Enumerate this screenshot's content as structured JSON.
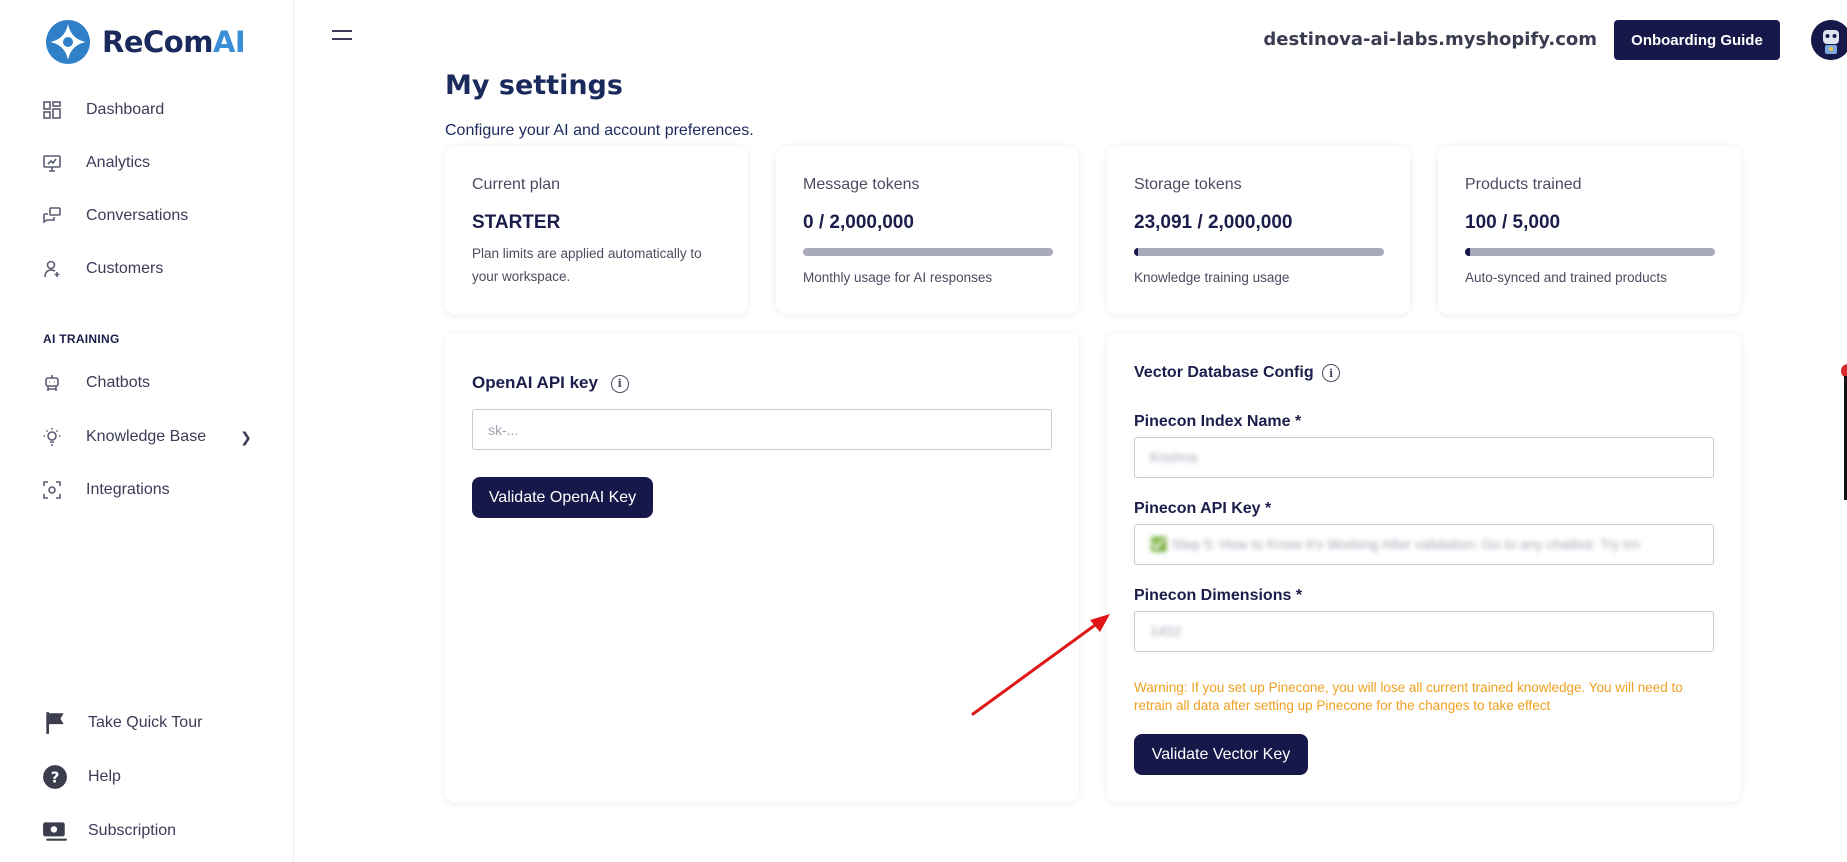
{
  "brand": {
    "name_main": "ReCom",
    "name_accent": "AI"
  },
  "sidebar": {
    "items": [
      {
        "label": "Dashboard",
        "icon": "dashboard-icon"
      },
      {
        "label": "Analytics",
        "icon": "analytics-icon"
      },
      {
        "label": "Conversations",
        "icon": "conversations-icon"
      },
      {
        "label": "Customers",
        "icon": "customers-icon"
      }
    ],
    "section_label": "AI TRAINING",
    "training_items": [
      {
        "label": "Chatbots",
        "icon": "chatbot-icon"
      },
      {
        "label": "Knowledge Base",
        "icon": "lightbulb-icon"
      },
      {
        "label": "Integrations",
        "icon": "integrations-icon"
      }
    ],
    "bottom_items": [
      {
        "label": "Take Quick Tour",
        "icon": "flag-icon"
      },
      {
        "label": "Help",
        "icon": "help-icon"
      },
      {
        "label": "Subscription",
        "icon": "subscription-icon"
      }
    ]
  },
  "header": {
    "store_domain": "destinova-ai-labs.myshopify.com",
    "onboarding_label": "Onboarding Guide"
  },
  "page": {
    "title": "My settings",
    "subtitle": "Configure your AI and account preferences."
  },
  "stats": [
    {
      "label": "Current plan",
      "value": "STARTER",
      "desc": "Plan limits are applied automatically to your workspace."
    },
    {
      "label": "Message tokens",
      "value": "0 / 2,000,000",
      "desc": "Monthly usage for AI responses",
      "progress": 0.0
    },
    {
      "label": "Storage tokens",
      "value": "23,091 / 2,000,000",
      "desc": "Knowledge training usage",
      "progress": 0.0115
    },
    {
      "label": "Products trained",
      "value": "100 / 5,000",
      "desc": "Auto-synced and trained products",
      "progress": 0.02
    }
  ],
  "openai": {
    "title": "OpenAI API key",
    "placeholder": "sk-...",
    "button": "Validate OpenAI Key"
  },
  "vector": {
    "title": "Vector Database Config",
    "index_label": "Pinecon Index Name *",
    "index_value": "Krishna",
    "api_label": "Pinecon API Key *",
    "api_value": "✅ Step 5: How to Know It's Working After validation: Go to any chatbot. Try trn",
    "dim_label": "Pinecon Dimensions *",
    "dim_value": "1452",
    "warning": "Warning: If you set up Pinecone, you will lose all current trained knowledge. You will need to retrain all data after setting up Pinecone for the changes to take effect",
    "button": "Validate Vector Key"
  },
  "colors": {
    "primary": "#17184a",
    "warning": "#f0a020",
    "arrow": "#e01515",
    "brand_accent": "#3b8fd6"
  }
}
